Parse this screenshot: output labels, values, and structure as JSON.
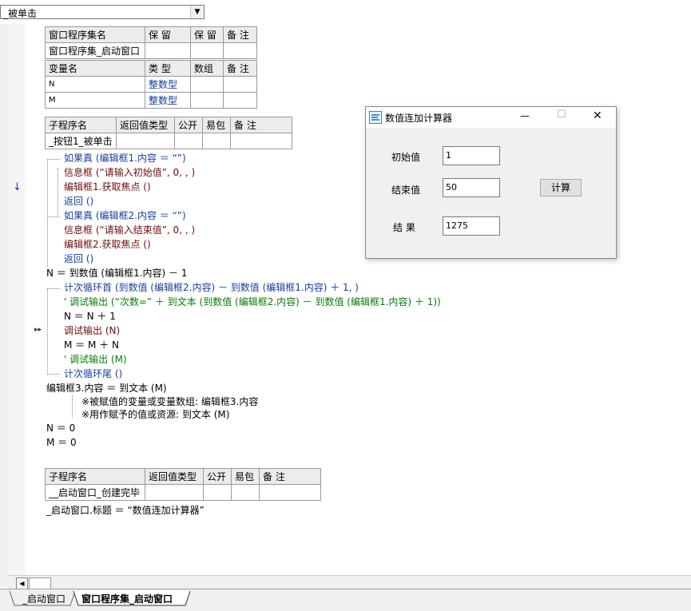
{
  "top_select": {
    "value": "_被单击"
  },
  "table1": {
    "header": [
      "窗口程序集名",
      "保 留",
      "保 留",
      "备 注"
    ],
    "row": [
      "窗口程序集_启动窗口",
      "",
      "",
      ""
    ]
  },
  "table2": {
    "header": [
      "变量名",
      "类 型",
      "数组",
      "备 注"
    ],
    "rows": [
      [
        "N",
        "整数型",
        "",
        ""
      ],
      [
        "M",
        "整数型",
        "",
        ""
      ]
    ]
  },
  "table3": {
    "header": [
      "子程序名",
      "返回值类型",
      "公开",
      "易包",
      "备 注"
    ],
    "row": [
      "_按钮1_被单击",
      "",
      "",
      "",
      ""
    ]
  },
  "code": {
    "l1": "如果真 (编辑框1.内容 ＝ “”)",
    "l2": "信息框 (“请输入初始值”, 0, , )",
    "l3": "编辑框1.获取焦点 ()",
    "l4": "返回 ()",
    "l5": "如果真 (编辑框2.内容 ＝ “”)",
    "l6": "信息框 (“请输入结束值”, 0, , )",
    "l7": "编辑框2.获取焦点 ()",
    "l8": "返回 ()",
    "l9": "N ＝ 到数值 (编辑框1.内容) － 1",
    "l10": "计次循环首 (到数值 (编辑框2.内容) － 到数值 (编辑框1.内容) ＋ 1, )",
    "l11": "' 调试输出 (“次数=” ＋ 到文本 (到数值 (编辑框2.内容) － 到数值 (编辑框1.内容) ＋ 1))",
    "l12": "N ＝ N ＋ 1",
    "l13": "调试输出 (N)",
    "l14": "M ＝ M ＋ N",
    "l15": "' 调试输出 (M)",
    "l16": "计次循环尾 ()",
    "l17": "编辑框3.内容 ＝ 到文本 (M)",
    "l18": "※被赋值的变量或变量数组: 编辑框3.内容",
    "l19": "※用作赋予的值或资源: 到文本 (M)",
    "l20": "N ＝ 0",
    "l21": "M ＝ 0"
  },
  "table4": {
    "header": [
      "子程序名",
      "返回值类型",
      "公开",
      "易包",
      "备 注"
    ],
    "row": [
      "__启动窗口_创建完毕",
      "",
      "",
      "",
      ""
    ]
  },
  "code2": {
    "l1": "_启动窗口.标题 ＝ “数值连加计算器”"
  },
  "gutter": {
    "arrow": "↓",
    "exec": "▸▸"
  },
  "tabs": [
    "_启动窗口",
    "窗口程序集_启动窗口"
  ],
  "dialog": {
    "title": "数值连加计算器",
    "min": "—",
    "max": "☐",
    "close": "✕",
    "label_start": "初始值",
    "value_start": "1",
    "label_end": "结束值",
    "value_end": "50",
    "button": "计算",
    "label_result": "结 果",
    "value_result": "1275"
  },
  "colors": {
    "keyword": "#1a3d9a",
    "string": "#006f8a",
    "comment": "#0a7a0a",
    "function": "#6b0e0e"
  }
}
